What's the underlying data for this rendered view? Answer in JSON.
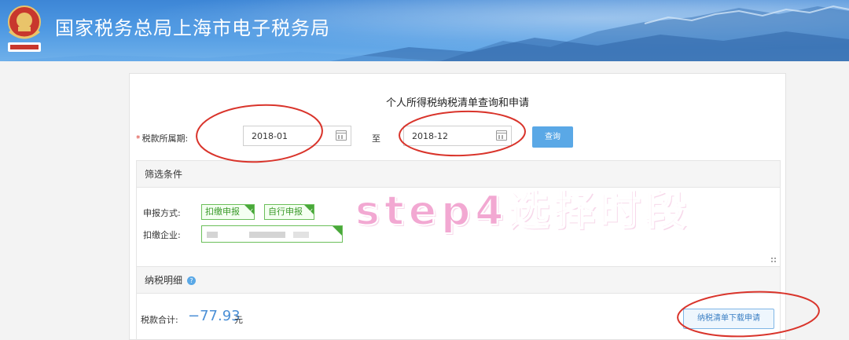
{
  "header": {
    "site_title": "国家税务总局上海市电子税务局",
    "emblem_name": "tax-emblem-icon",
    "colors": {
      "banner": "#4d98e2",
      "text": "#ffffff"
    }
  },
  "page": {
    "heading": "个人所得税纳税清单查询和申请"
  },
  "period": {
    "required_mark": "*",
    "label": "税款所属期:",
    "start_value": "2018-01",
    "separator": "至",
    "end_value": "2018-12",
    "query_button": "查询"
  },
  "filter": {
    "title": "筛选条件",
    "declare_label": "申报方式:",
    "declare_options": [
      "扣缴申报",
      "自行申报"
    ],
    "company_label": "扣缴企业:",
    "company_value": ""
  },
  "detail": {
    "title": "纳税明细",
    "help_glyph": "?",
    "total_label": "税款合计:",
    "total_value": "−77.93",
    "total_unit": "元",
    "download_button": "纳税清单下载申请"
  },
  "annotation": {
    "text": "step4选择时段",
    "color": "#f2a8d2",
    "circle_color": "#d9342b"
  }
}
